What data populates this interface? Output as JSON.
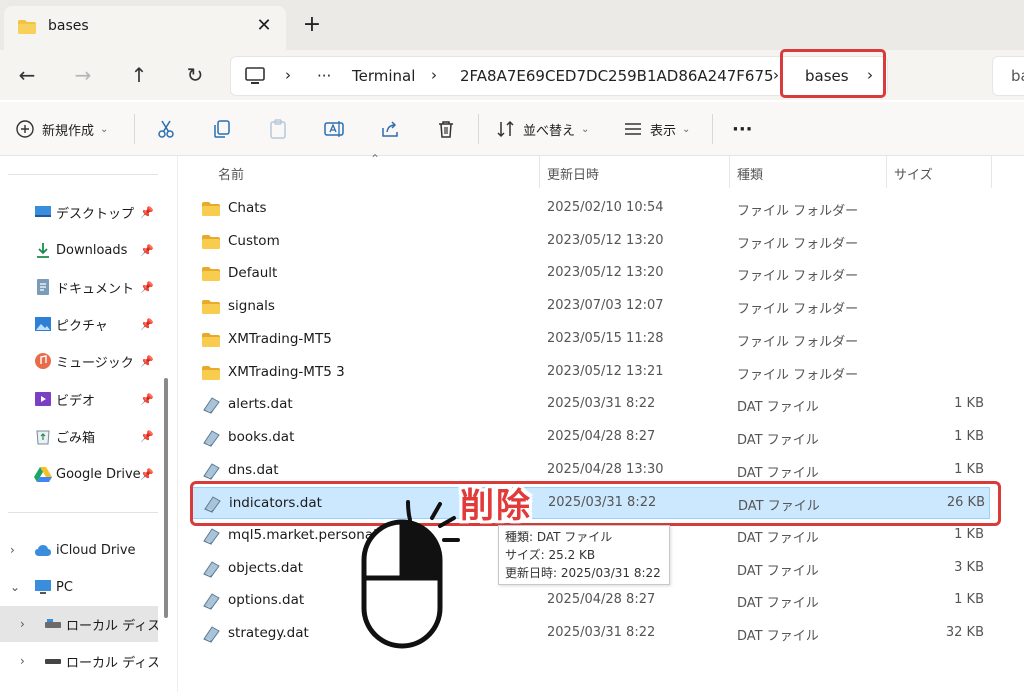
{
  "tab": {
    "title": "bases",
    "close": "✕",
    "new": "+"
  },
  "nav": {
    "back": "←",
    "forward": "→",
    "up": "↑",
    "refresh": "↻"
  },
  "address": {
    "more": "···",
    "segments": [
      "Terminal",
      "2FA8A7E69CED7DC259B1AD86A247F675",
      "bases"
    ],
    "search_partial": "ba"
  },
  "toolbar": {
    "new_label": "新規作成",
    "sort_label": "並べ替え",
    "view_label": "表示",
    "more_label": "···"
  },
  "sidebar": {
    "quick": [
      {
        "label": "デスクトップ",
        "icon": "desktop-icon"
      },
      {
        "label": "Downloads",
        "icon": "download-icon"
      },
      {
        "label": "ドキュメント",
        "icon": "document-icon"
      },
      {
        "label": "ピクチャ",
        "icon": "picture-icon"
      },
      {
        "label": "ミュージック",
        "icon": "music-icon"
      },
      {
        "label": "ビデオ",
        "icon": "video-icon"
      },
      {
        "label": "ごみ箱",
        "icon": "recycle-bin-icon"
      },
      {
        "label": "Google Drive",
        "icon": "google-drive-icon"
      }
    ],
    "tree": [
      {
        "label": "iCloud Drive",
        "expander": "›"
      },
      {
        "label": "PC",
        "expander": "⌄"
      },
      {
        "label": "ローカル ディスク (",
        "expander": "›"
      },
      {
        "label": "ローカル ディスク (",
        "expander": "›"
      }
    ]
  },
  "columns": {
    "name": "名前",
    "date": "更新日時",
    "type": "種類",
    "size": "サイズ"
  },
  "files": [
    {
      "name": "Chats",
      "date": "2025/02/10 10:54",
      "type": "ファイル フォルダー",
      "size": "",
      "kind": "folder"
    },
    {
      "name": "Custom",
      "date": "2023/05/12 13:20",
      "type": "ファイル フォルダー",
      "size": "",
      "kind": "folder"
    },
    {
      "name": "Default",
      "date": "2023/05/12 13:20",
      "type": "ファイル フォルダー",
      "size": "",
      "kind": "folder"
    },
    {
      "name": "signals",
      "date": "2023/07/03 12:07",
      "type": "ファイル フォルダー",
      "size": "",
      "kind": "folder"
    },
    {
      "name": "XMTrading-MT5",
      "date": "2023/05/15 11:28",
      "type": "ファイル フォルダー",
      "size": "",
      "kind": "folder"
    },
    {
      "name": "XMTrading-MT5 3",
      "date": "2023/05/12 13:21",
      "type": "ファイル フォルダー",
      "size": "",
      "kind": "folder"
    },
    {
      "name": "alerts.dat",
      "date": "2025/03/31 8:22",
      "type": "DAT ファイル",
      "size": "1 KB",
      "kind": "file"
    },
    {
      "name": "books.dat",
      "date": "2025/04/28 8:27",
      "type": "DAT ファイル",
      "size": "1 KB",
      "kind": "file"
    },
    {
      "name": "dns.dat",
      "date": "2025/04/28 13:30",
      "type": "DAT ファイル",
      "size": "1 KB",
      "kind": "file"
    },
    {
      "name": "indicators.dat",
      "date": "2025/03/31 8:22",
      "type": "DAT ファイル",
      "size": "26 KB",
      "kind": "file",
      "selected": true
    },
    {
      "name": "mql5.market.personal.dat",
      "date": "",
      "type": "DAT ファイル",
      "size": "1 KB",
      "kind": "file"
    },
    {
      "name": "objects.dat",
      "date": "",
      "type": "DAT ファイル",
      "size": "3 KB",
      "kind": "file"
    },
    {
      "name": "options.dat",
      "date": "2025/04/28 8:27",
      "type": "DAT ファイル",
      "size": "1 KB",
      "kind": "file"
    },
    {
      "name": "strategy.dat",
      "date": "2025/03/31 8:22",
      "type": "DAT ファイル",
      "size": "32 KB",
      "kind": "file"
    }
  ],
  "annotation": {
    "label": "削除"
  },
  "tooltip": {
    "type_line": "種類: DAT ファイル",
    "size_line": "サイズ: 25.2 KB",
    "date_line": "更新日時: 2025/03/31 8:22"
  },
  "colors": {
    "accent_red": "#d93a3a",
    "selection": "#cce8ff",
    "folder": "#f5c342"
  }
}
